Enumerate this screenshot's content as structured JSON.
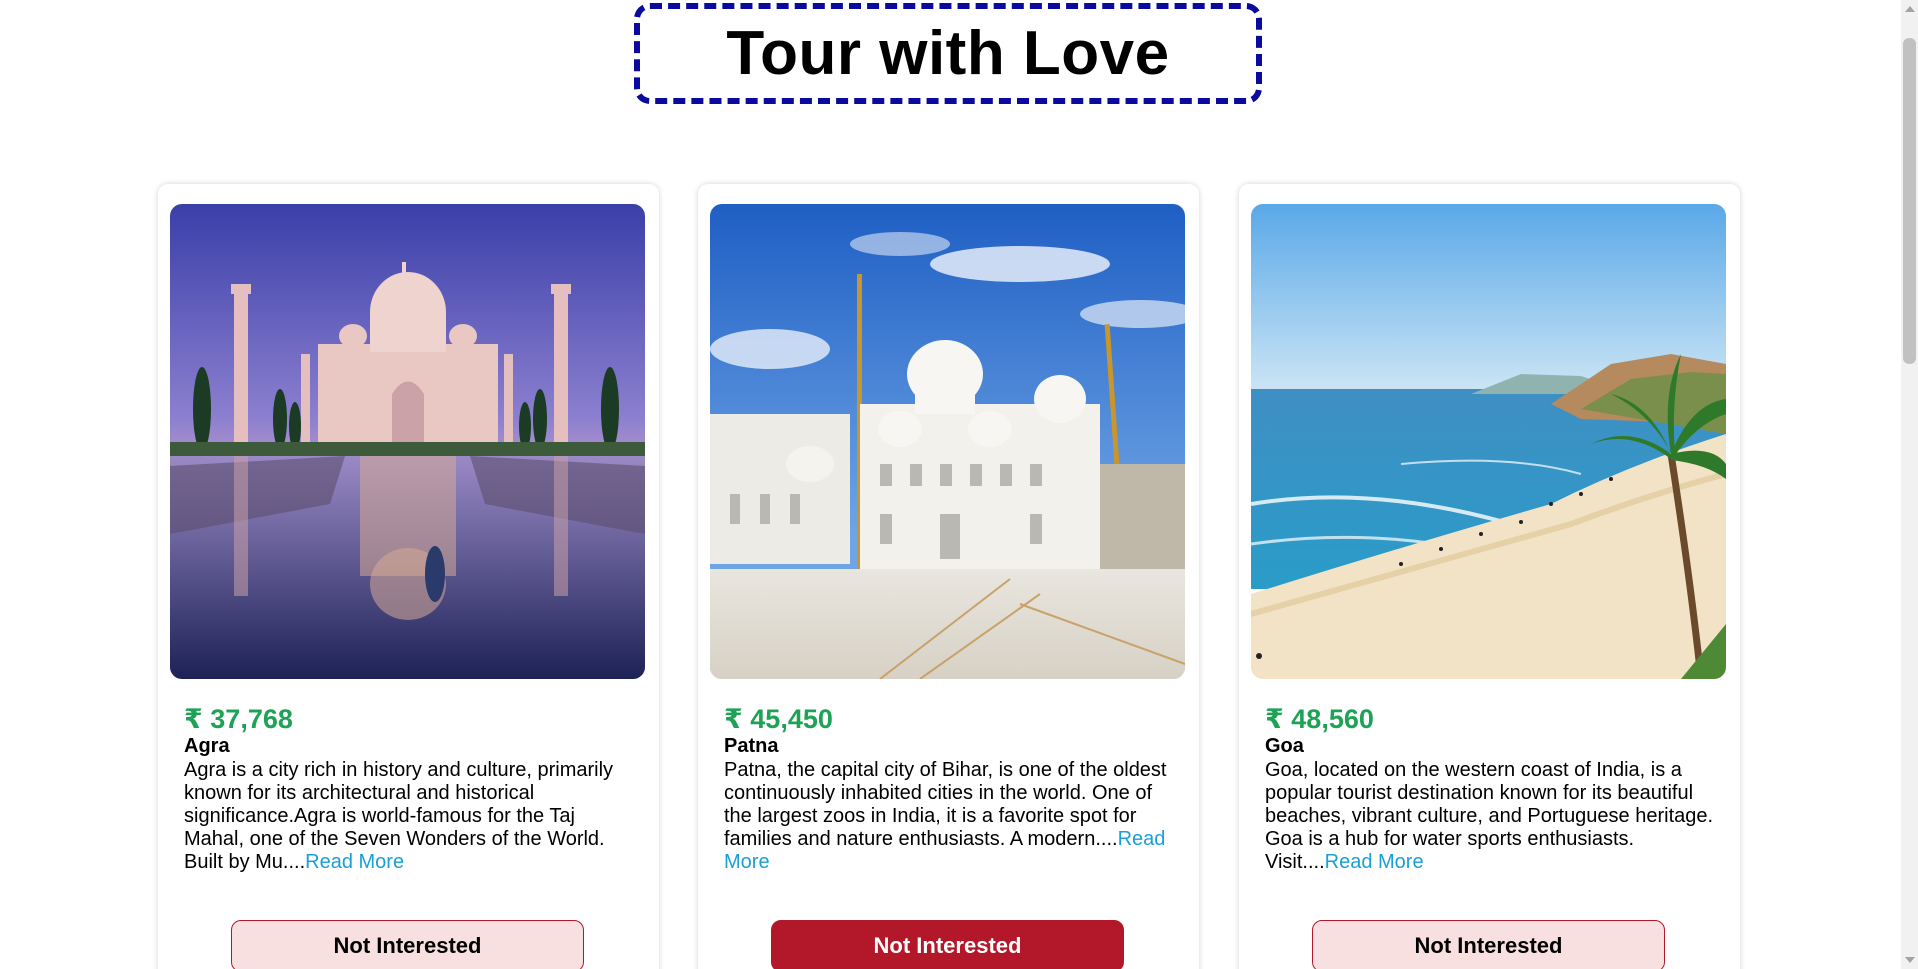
{
  "header": {
    "title": "Tour with Love"
  },
  "colors": {
    "title_border": "#0a0a9e",
    "price": "#1ea356",
    "link": "#1aa0d6",
    "button_accent": "#b3182a",
    "button_light_bg": "#f8e0e0"
  },
  "tours": [
    {
      "price": "₹ 37,768",
      "city": "Agra",
      "description": "Agra is a city rich in history and culture, primarily known for its architectural and historical significance.Agra is world-famous for the Taj Mahal, one of the Seven Wonders of the World. Built by Mu....",
      "read_more": "Read More",
      "button_label": "Not Interested",
      "image_subject": "taj-mahal"
    },
    {
      "price": "₹ 45,450",
      "city": "Patna",
      "description": "Patna, the capital city of Bihar, is one of the oldest continuously inhabited cities in the world. One of the largest zoos in India, it is a favorite spot for families and nature enthusiasts. A modern....",
      "read_more": "Read More",
      "button_label": "Not Interested",
      "image_subject": "gurudwara"
    },
    {
      "price": "₹ 48,560",
      "city": "Goa",
      "description": "Goa, located on the western coast of India, is a popular tourist destination known for its beautiful beaches, vibrant culture, and Portuguese heritage. Goa is a hub for water sports enthusiasts. Visit....",
      "read_more": "Read More",
      "button_label": "Not Interested",
      "image_subject": "beach"
    }
  ]
}
